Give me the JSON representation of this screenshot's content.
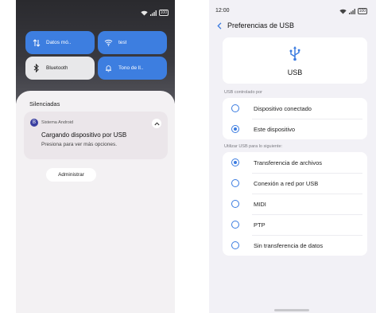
{
  "left": {
    "status_icons": [
      "wifi-icon",
      "signal-icon",
      "battery-icon"
    ],
    "battery": "100",
    "tiles": [
      {
        "icon": "data-transfer-icon",
        "label": "Datos mó..",
        "active": true
      },
      {
        "icon": "wifi-icon",
        "label": "test",
        "active": true
      },
      {
        "icon": "bluetooth-icon",
        "label": "Bluetooth",
        "active": false
      },
      {
        "icon": "bell-icon",
        "label": "Tono de ll..",
        "active": true
      }
    ],
    "section_title": "Silenciadas",
    "notification": {
      "app_icon": "android-system-icon",
      "app_initial": "B",
      "app_name": "Sistema Android",
      "title": "Cargando dispositivo por USB",
      "text": "Presiona para ver más opciones."
    },
    "manage_button": "Administrar"
  },
  "right": {
    "time": "12:00",
    "battery": "100",
    "title": "Preferencias de USB",
    "usb_label": "USB",
    "group1_label": "USB controlado por",
    "group1_options": [
      {
        "label": "Dispositivo conectado",
        "checked": false
      },
      {
        "label": "Este dispositivo",
        "checked": true
      }
    ],
    "group2_label": "Utilizar USB para lo siguiente:",
    "group2_options": [
      {
        "label": "Transferencia de archivos",
        "checked": true
      },
      {
        "label": "Conexión a red por USB",
        "checked": false
      },
      {
        "label": "MIDI",
        "checked": false
      },
      {
        "label": "PTP",
        "checked": false
      },
      {
        "label": "Sin transferencia de datos",
        "checked": false
      }
    ]
  },
  "colors": {
    "accent": "#3d7ee0",
    "tile_inactive": "#e8e8ea",
    "shade_dark": "#2a2a2e"
  }
}
